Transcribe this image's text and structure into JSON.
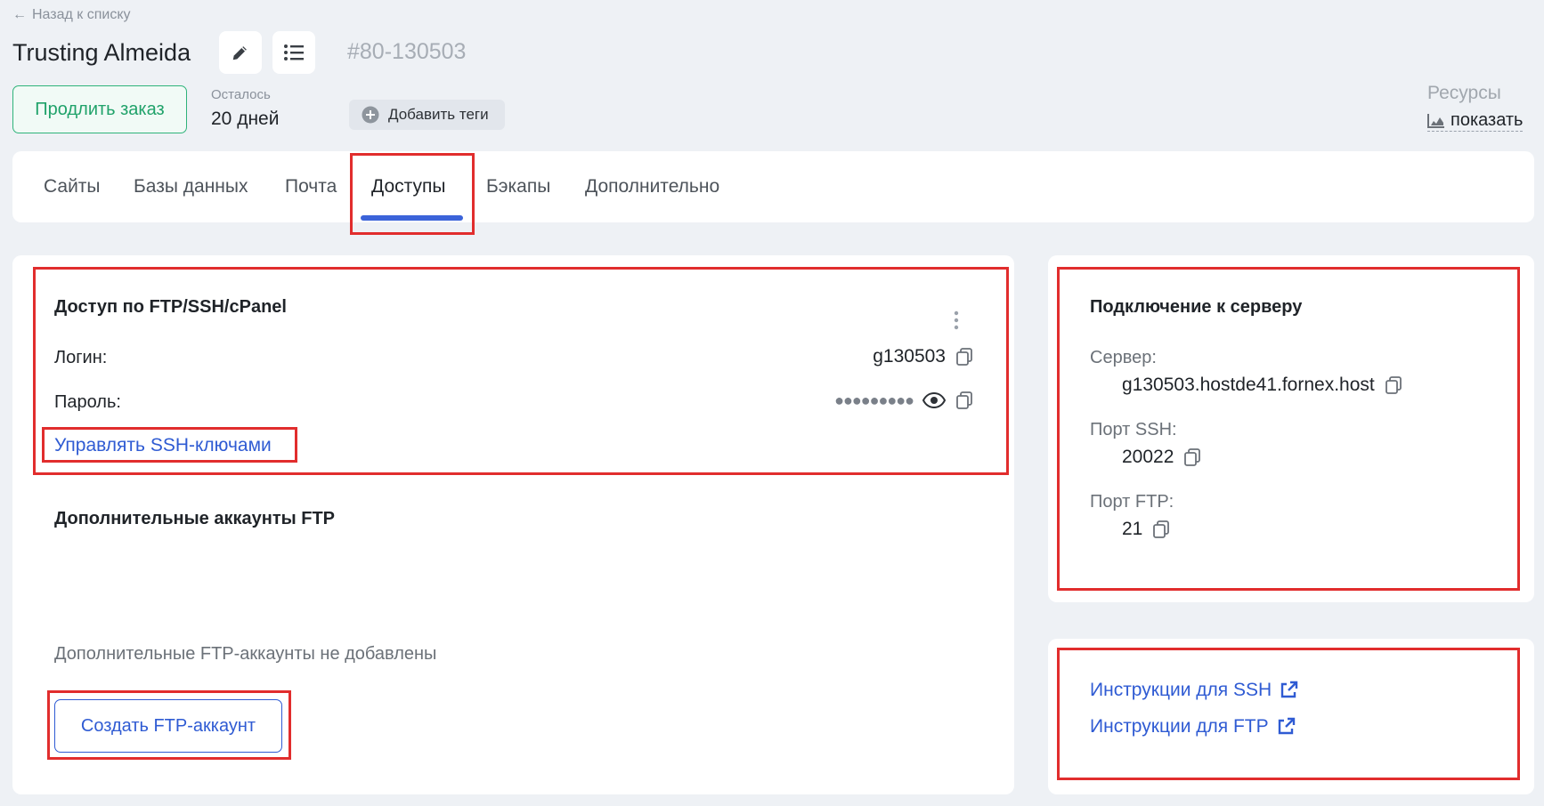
{
  "header": {
    "back_label": "Назад к списку",
    "title": "Trusting Almeida",
    "order_id": "#80-130503",
    "renew_label": "Продлить заказ",
    "remaining_label": "Осталось",
    "remaining_value": "20 дней",
    "tags_label": "Добавить теги",
    "resources_label": "Ресурсы",
    "resources_show": "показать"
  },
  "tabs": [
    {
      "label": "Сайты"
    },
    {
      "label": "Базы данных"
    },
    {
      "label": "Почта"
    },
    {
      "label": "Доступы"
    },
    {
      "label": "Бэкапы"
    },
    {
      "label": "Дополнительно"
    }
  ],
  "active_tab": "Доступы",
  "access": {
    "title": "Доступ по FTP/SSH/cPanel",
    "login_label": "Логин:",
    "login_value": "g130503",
    "password_label": "Пароль:",
    "password_mask": "●●●●●●●●●",
    "ssh_keys_link": "Управлять SSH-ключами"
  },
  "extra_ftp": {
    "title": "Дополнительные аккаунты FTP",
    "empty_text": "Дополнительные FTP-аккаунты не добавлены",
    "create_button": "Создать FTP-аккаунт"
  },
  "server": {
    "title": "Подключение к серверу",
    "server_label": "Сервер:",
    "server_value": "g130503.hostde41.fornex.host",
    "ssh_port_label": "Порт SSH:",
    "ssh_port_value": "20022",
    "ftp_port_label": "Порт FTP:",
    "ftp_port_value": "21"
  },
  "instructions": {
    "ssh_link": "Инструкции для SSH",
    "ftp_link": "Инструкции для FTP"
  },
  "colors": {
    "accent": "#3b63d9",
    "link": "#2f5bd3",
    "renew": "#20a26a",
    "highlight": "#e12d2d",
    "background": "#eef1f5"
  }
}
